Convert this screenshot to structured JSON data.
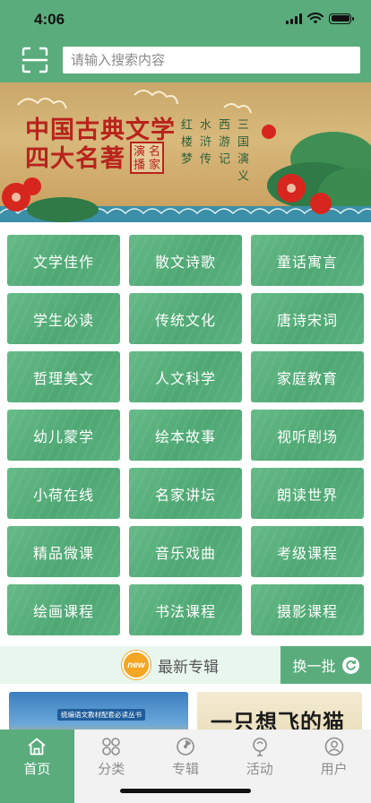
{
  "status_bar": {
    "time": "4:06"
  },
  "header": {
    "search_placeholder": "请输入搜索内容",
    "scan_icon": "scan-icon"
  },
  "banner": {
    "title_line1": "中国古典文学",
    "title_line2": "四大名著",
    "seal": [
      "演",
      "名",
      "播",
      "家"
    ],
    "columns": [
      "红楼梦",
      "水浒传",
      "西游记",
      "三国演义"
    ]
  },
  "categories": [
    "文学佳作",
    "散文诗歌",
    "童话寓言",
    "学生必读",
    "传统文化",
    "唐诗宋词",
    "哲理美文",
    "人文科学",
    "家庭教育",
    "幼儿蒙学",
    "绘本故事",
    "视听剧场",
    "小荷在线",
    "名家讲坛",
    "朗读世界",
    "精品微课",
    "音乐戏曲",
    "考级课程",
    "绘画课程",
    "书法课程",
    "摄影课程"
  ],
  "album_section": {
    "badge": "new",
    "title": "最新专辑",
    "refresh_label": "换一批"
  },
  "albums": [
    {
      "label": "统编语文教材配套必读丛书"
    },
    {
      "label": "一只想飞的猫"
    }
  ],
  "tabbar": [
    {
      "label": "首页",
      "icon": "home-icon",
      "active": true
    },
    {
      "label": "分类",
      "icon": "category-icon",
      "active": false
    },
    {
      "label": "专辑",
      "icon": "album-icon",
      "active": false
    },
    {
      "label": "活动",
      "icon": "activity-icon",
      "active": false
    },
    {
      "label": "用户",
      "icon": "user-icon",
      "active": false
    }
  ],
  "colors": {
    "primary": "#5aac7c",
    "accent": "#f5a623",
    "title_red": "#b8231c"
  }
}
